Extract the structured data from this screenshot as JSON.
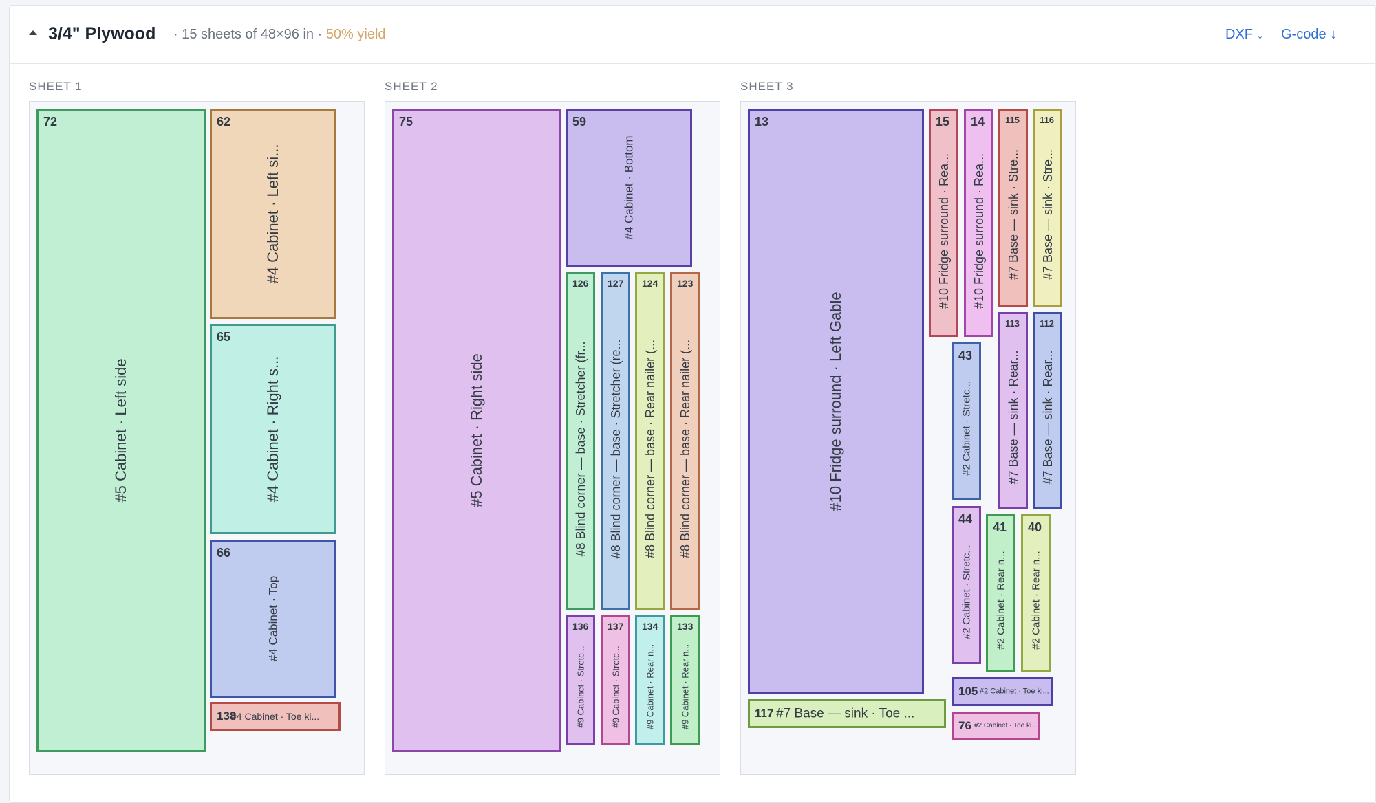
{
  "header": {
    "title": "3/4\" Plywood",
    "summary": "· 15 sheets of 48×96 in ·",
    "yield": "50% yield",
    "dxf_label": "DXF ↓",
    "gcode_label": "G-code ↓"
  },
  "colors": {
    "yield": "#d2a66a",
    "link": "#2f6fd6",
    "green": "#c0efd3",
    "tan": "#f0d7b9",
    "cyan": "#c0efe6",
    "periwinkle": "#c0ccef",
    "salmon": "#f0c0bd",
    "lavender": "#c9bdf0",
    "violet": "#e0c0ef",
    "pink": "#efc0e3",
    "lime": "#d9efbd",
    "yellow": "#efefc0",
    "sky": "#c0d6ef"
  },
  "sheets": [
    {
      "label": "SHEET 1",
      "parts": [
        {
          "id": "72",
          "label": "#5 Cabinet · Left side"
        },
        {
          "id": "62",
          "label": "#4 Cabinet · Left si..."
        },
        {
          "id": "65",
          "label": "#4 Cabinet · Right s..."
        },
        {
          "id": "66",
          "label": "#4 Cabinet · Top"
        },
        {
          "id": "138",
          "label": "#4 Cabinet · Toe ki..."
        }
      ]
    },
    {
      "label": "SHEET 2",
      "parts": [
        {
          "id": "75",
          "label": "#5 Cabinet · Right side"
        },
        {
          "id": "59",
          "label": "#4 Cabinet · Bottom"
        },
        {
          "id": "126",
          "label": "#8 Blind corner — base · Stretcher (fr..."
        },
        {
          "id": "127",
          "label": "#8 Blind corner — base · Stretcher (re..."
        },
        {
          "id": "124",
          "label": "#8 Blind corner — base · Rear nailer (..."
        },
        {
          "id": "123",
          "label": "#8 Blind corner — base · Rear nailer (..."
        },
        {
          "id": "136",
          "label": "#9 Cabinet · Stretc..."
        },
        {
          "id": "137",
          "label": "#9 Cabinet · Stretc..."
        },
        {
          "id": "134",
          "label": "#9 Cabinet · Rear n..."
        },
        {
          "id": "133",
          "label": "#9 Cabinet · Rear n..."
        }
      ]
    },
    {
      "label": "SHEET 3",
      "parts": [
        {
          "id": "13",
          "label": "#10 Fridge surround · Left Gable"
        },
        {
          "id": "15",
          "label": "#10 Fridge surround · Rea..."
        },
        {
          "id": "14",
          "label": "#10 Fridge surround · Rea..."
        },
        {
          "id": "115",
          "label": "#7 Base — sink · Stre..."
        },
        {
          "id": "116",
          "label": "#7 Base — sink · Stre..."
        },
        {
          "id": "43",
          "label": "#2 Cabinet · Stretc..."
        },
        {
          "id": "113",
          "label": "#7 Base — sink · Rear..."
        },
        {
          "id": "112",
          "label": "#7 Base — sink · Rear..."
        },
        {
          "id": "44",
          "label": "#2 Cabinet · Stretc..."
        },
        {
          "id": "41",
          "label": "#2 Cabinet · Rear n..."
        },
        {
          "id": "40",
          "label": "#2 Cabinet · Rear n..."
        },
        {
          "id": "117",
          "label": "#7 Base — sink · Toe ..."
        },
        {
          "id": "105",
          "label": "#2 Cabinet · Toe ki..."
        },
        {
          "id": "76",
          "label": "#2 Cabinet · Toe ki..."
        }
      ]
    }
  ]
}
